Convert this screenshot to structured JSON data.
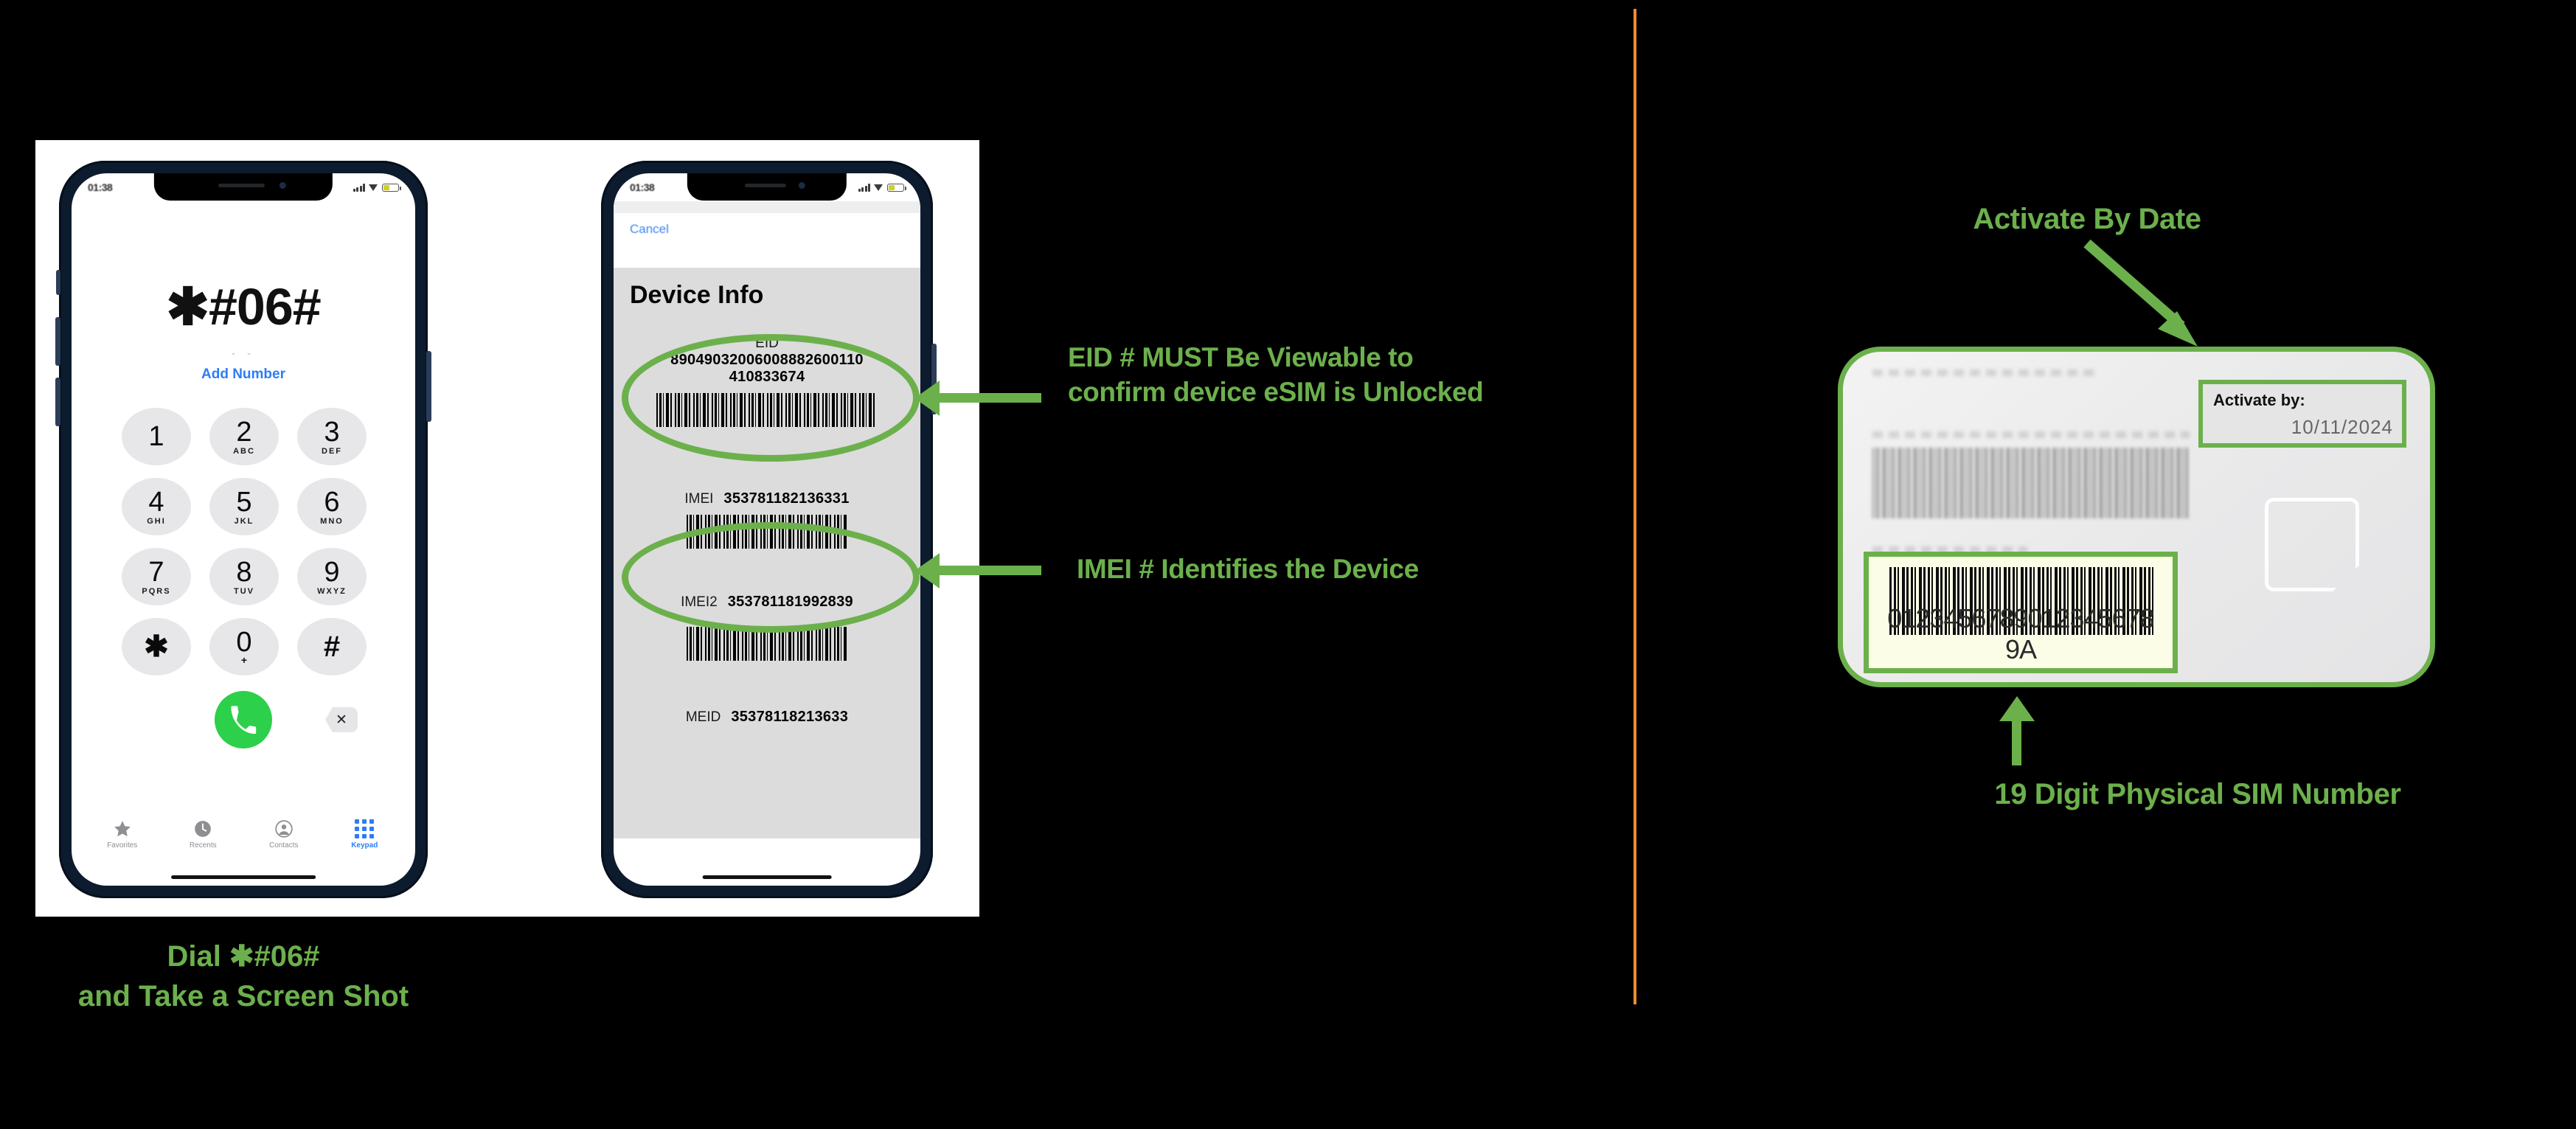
{
  "theme": {
    "background": "#000000",
    "accent_green": "#6CB04C",
    "divider_orange": "#F08A33",
    "ios_blue": "#2d7cf6",
    "call_green": "#2cd04a"
  },
  "left_panel": {
    "phone_dialer": {
      "status_bar": {
        "time": "01:38",
        "signal": "signal-bars",
        "wifi": "wifi",
        "battery": "battery"
      },
      "display_value": "✱#06#",
      "sub_dashes": "- -",
      "add_number_label": "Add Number",
      "keys": [
        {
          "num": "1",
          "letters": ""
        },
        {
          "num": "2",
          "letters": "ABC"
        },
        {
          "num": "3",
          "letters": "DEF"
        },
        {
          "num": "4",
          "letters": "GHI"
        },
        {
          "num": "5",
          "letters": "JKL"
        },
        {
          "num": "6",
          "letters": "MNO"
        },
        {
          "num": "7",
          "letters": "PQRS"
        },
        {
          "num": "8",
          "letters": "TUV"
        },
        {
          "num": "9",
          "letters": "WXYZ"
        },
        {
          "num": "✱",
          "letters": ""
        },
        {
          "num": "0",
          "letters": "+"
        },
        {
          "num": "#",
          "letters": ""
        }
      ],
      "call_button": "call",
      "delete_button": "✕",
      "tabs": [
        {
          "label": "Favorites",
          "icon": "star-icon",
          "active": false
        },
        {
          "label": "Recents",
          "icon": "clock-icon",
          "active": false
        },
        {
          "label": "Contacts",
          "icon": "person-icon",
          "active": false
        },
        {
          "label": "Keypad",
          "icon": "keypad-icon",
          "active": true
        }
      ]
    },
    "phone_device_info": {
      "status_bar": {
        "time": "01:38"
      },
      "cancel_label": "Cancel",
      "sheet_title": "Device Info",
      "rows": [
        {
          "label": "EID",
          "value_line1": "89049032006008882600110",
          "value_line2": "410833674",
          "layout": "stacked"
        },
        {
          "label": "IMEI",
          "value_line1": "353781182136331",
          "value_line2": "",
          "layout": "inline"
        },
        {
          "label": "IMEI2",
          "value_line1": "353781181992839",
          "value_line2": "",
          "layout": "inline"
        },
        {
          "label": "MEID",
          "value_line1": "35378118213633",
          "value_line2": "",
          "layout": "inline"
        }
      ]
    },
    "annotations": {
      "eid_note_line1": "EID # MUST Be Viewable to",
      "eid_note_line2": "confirm device eSIM is Unlocked",
      "imei_note": "IMEI # Identifies the Device"
    },
    "caption_line1": "Dial  ✱#06#",
    "caption_line2": "and Take a Screen Shot"
  },
  "right_panel": {
    "title_annotation": "Activate By Date",
    "bottom_annotation": "19 Digit Physical SIM Number",
    "sim_card": {
      "activate_by_label": "Activate by:",
      "activate_by_date": "10/11/2024",
      "iccid": "0123456789012345678 9A",
      "chip": "sim-chip"
    }
  }
}
